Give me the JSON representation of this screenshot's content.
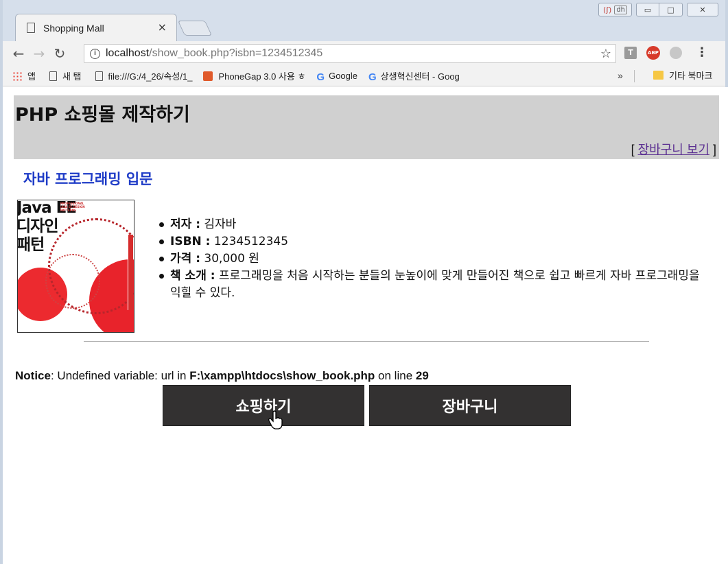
{
  "browser": {
    "tab_title": "Shopping Mall",
    "tab_close": "×",
    "url_host": "localhost",
    "url_path": "/show_book.php?isbn=1234512345",
    "ext_t": "T",
    "ext_abp": "ABP",
    "win_ext_label": "(ʃ)",
    "win_ext_dh": "dh",
    "win_minimize": "▭",
    "win_maximize": "□",
    "win_close": "✕"
  },
  "bookmarks": {
    "items": [
      {
        "label": "앱",
        "icon": "apps-icon"
      },
      {
        "label": "새 탭",
        "icon": "page-icon"
      },
      {
        "label": "file:///G:/4_26/속성/1_",
        "icon": "page-icon"
      },
      {
        "label": "PhoneGap 3.0 사용 ㅎ",
        "icon": "phonegap-icon"
      },
      {
        "label": "Google",
        "icon": "google-icon"
      },
      {
        "label": "상생혁신센터 - Goog",
        "icon": "google-icon"
      }
    ],
    "more": "»",
    "other": "기타 북마크"
  },
  "page": {
    "site_title": "PHP 쇼핑몰 제작하기",
    "cart_link_open": "[ ",
    "cart_link": "장바구니 보기",
    "cart_link_close": " ]",
    "book_title": "자바 프로그래밍 입문",
    "cover": {
      "line1": "Java EE",
      "line2": "디자인",
      "line3": "패턴",
      "sub": "PROFESSIONAL JAVA EE DESIGN PATTERNS"
    },
    "author_label": "저자 :",
    "author": " 김자바",
    "isbn_label": "ISBN :",
    "isbn": " 1234512345",
    "price_label": "가격 :",
    "price": " 30,000 원",
    "desc_label": "책 소개 :",
    "desc": " 프로그래밍을 처음 시작하는 분들의 눈높이에 맞게 만들어진 책으로 쉽고 빠르게 자바 프로그래밍을 익힐 수 있다.",
    "notice_label": "Notice",
    "notice_text": ": Undefined variable: url in ",
    "notice_file": "F:\\xampp\\htdocs\\show_book.php",
    "notice_online": " on line ",
    "notice_line": "29",
    "btn_shop": "쇼핑하기",
    "btn_cart": "장바구니"
  }
}
